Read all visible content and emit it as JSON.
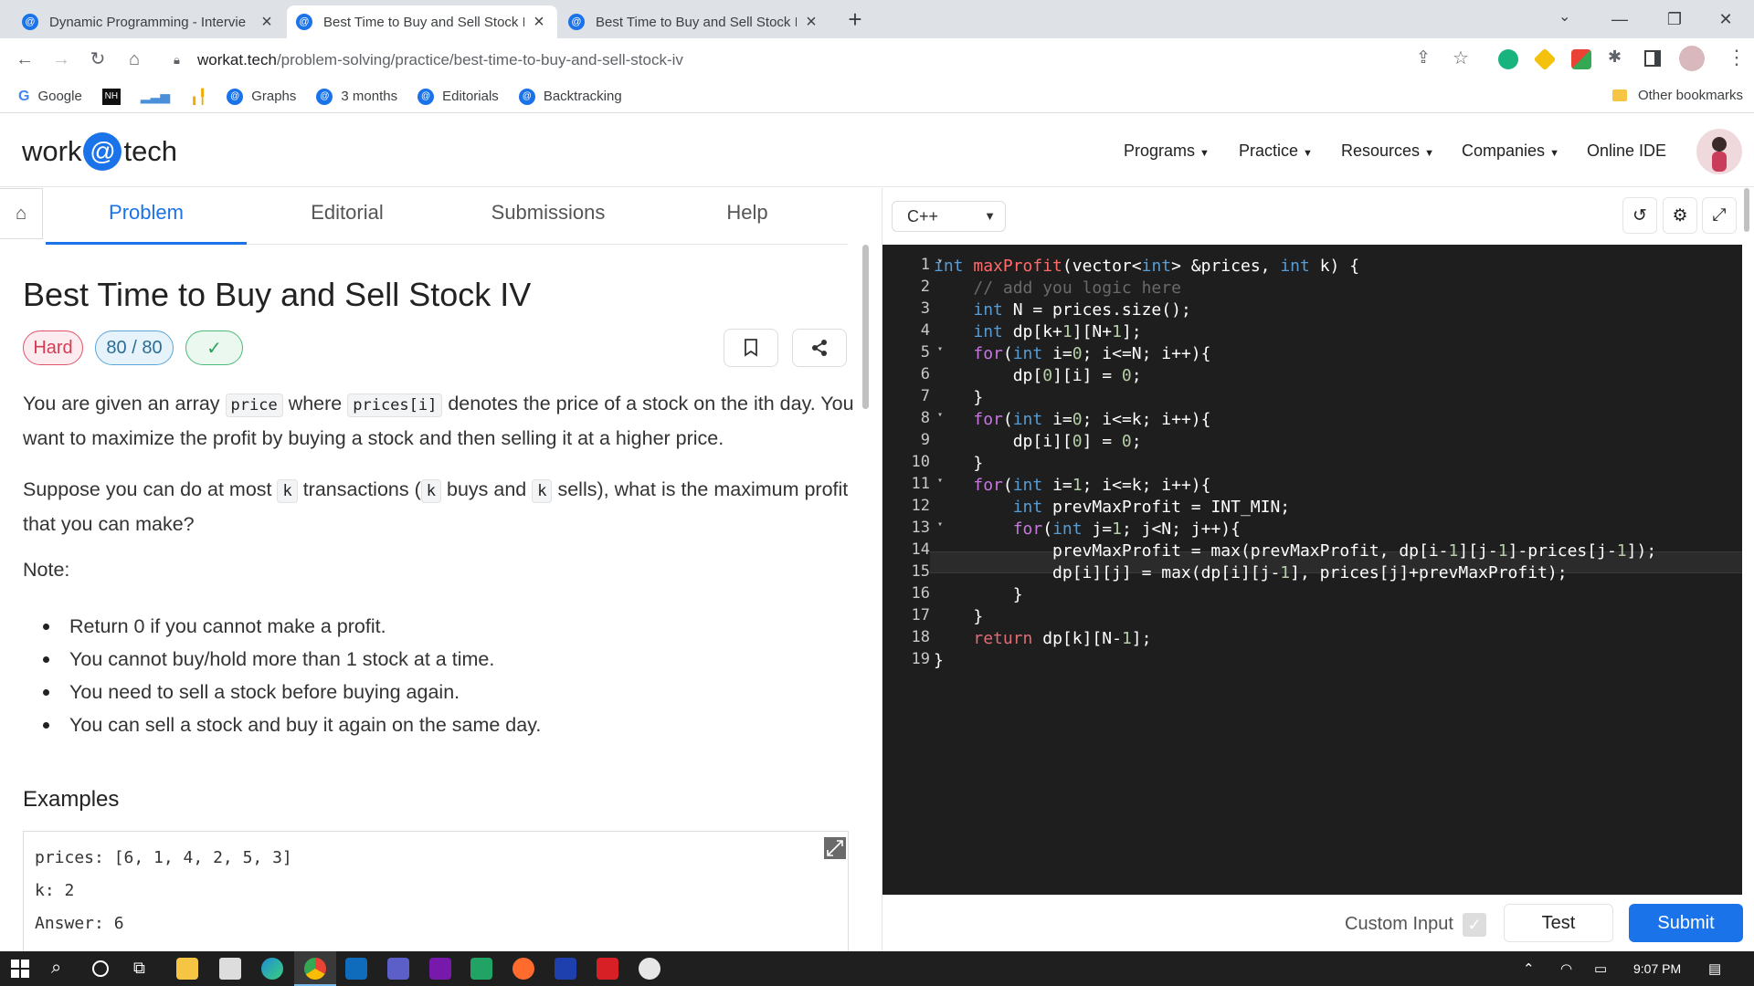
{
  "browser": {
    "tabs": [
      {
        "title": "Dynamic Programming - Intervie",
        "active": false
      },
      {
        "title": "Best Time to Buy and Sell Stock I",
        "active": true
      },
      {
        "title": "Best Time to Buy and Sell Stock I",
        "active": false
      }
    ],
    "new_tab_label": "+",
    "url_host": "workat.tech",
    "url_path": "/problem-solving/practice/best-time-to-buy-and-sell-stock-iv",
    "bookmarks": [
      {
        "label": "Google",
        "icon": "google-icon"
      },
      {
        "label": "",
        "icon": "nh-icon"
      },
      {
        "label": "",
        "icon": "chart-icon"
      },
      {
        "label": "",
        "icon": "bars-icon"
      },
      {
        "label": "Graphs",
        "icon": "workattech-icon"
      },
      {
        "label": "3 months",
        "icon": "workattech-icon"
      },
      {
        "label": "Editorials",
        "icon": "workattech-icon"
      },
      {
        "label": "Backtracking",
        "icon": "workattech-icon"
      }
    ],
    "other_bookmarks": "Other bookmarks"
  },
  "site": {
    "logo_left": "work",
    "logo_at": "@",
    "logo_right": "tech",
    "nav": [
      "Programs",
      "Practice",
      "Resources",
      "Companies",
      "Online IDE"
    ]
  },
  "problem": {
    "tabs": [
      "Problem",
      "Editorial",
      "Submissions",
      "Help"
    ],
    "active_tab": "Problem",
    "title": "Best Time to Buy and Sell Stock IV",
    "difficulty": "Hard",
    "score": "80 / 80",
    "solved_mark": "✓",
    "desc_1a": "You are given an array ",
    "desc_1_code1": "price",
    "desc_1b": " where ",
    "desc_1_code2": "prices[i]",
    "desc_1c": " denotes the price of a stock on the ith day. You want to maximize the profit by buying a stock and then selling it at a higher price.",
    "desc_2a": "Suppose you can do at most ",
    "desc_2_code1": "k",
    "desc_2b": " transactions (",
    "desc_2_code2": "k",
    "desc_2c": " buys and ",
    "desc_2_code3": "k",
    "desc_2d": " sells), what is the maximum profit that you can make?",
    "note_label": "Note:",
    "notes": [
      "Return 0 if you cannot make a profit.",
      "You cannot buy/hold more than 1 stock at a time.",
      "You need to sell a stock before buying again.",
      "You can sell a stock and buy it again on the same day."
    ],
    "examples_title": "Examples",
    "example_lines": [
      "prices: [6, 1, 4, 2, 5, 3]",
      "k: 2",
      "Answer: 6"
    ]
  },
  "editor": {
    "language": "C++",
    "line_numbers": [
      "1",
      "2",
      "3",
      "4",
      "5",
      "6",
      "7",
      "8",
      "9",
      "10",
      "11",
      "12",
      "13",
      "14",
      "15",
      "16",
      "17",
      "18",
      "19"
    ],
    "fold_lines": [
      1,
      5,
      8,
      11,
      13
    ],
    "active_line": 15,
    "custom_input_label": "Custom Input",
    "test_label": "Test",
    "submit_label": "Submit"
  },
  "taskbar": {
    "time": "9:07 PM"
  },
  "colors": {
    "accent": "#1a73e8",
    "hard": "#d23c54",
    "score": "#2b6c94",
    "solved": "#2e9e5b",
    "editor_bg": "#1e1e1e"
  }
}
